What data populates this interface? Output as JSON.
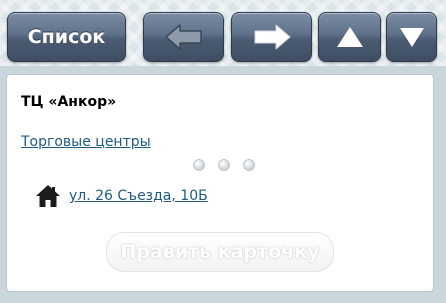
{
  "toolbar": {
    "list_label": "Список",
    "back_icon": "arrow-left-icon",
    "forward_icon": "arrow-right-icon",
    "up_icon": "triangle-up-icon",
    "down_icon": "triangle-down-icon"
  },
  "card": {
    "title": "ТЦ «Анкор»",
    "category_link": "Торговые центры",
    "address": "ул. 26 Съезда, 10Б",
    "address_icon": "house-icon",
    "edit_button": "Править карточку"
  },
  "colors": {
    "button_dark": "#4b5c73",
    "link": "#1f5a82",
    "card_bg": "#ffffff",
    "page_bg": "#c9d6dc"
  }
}
